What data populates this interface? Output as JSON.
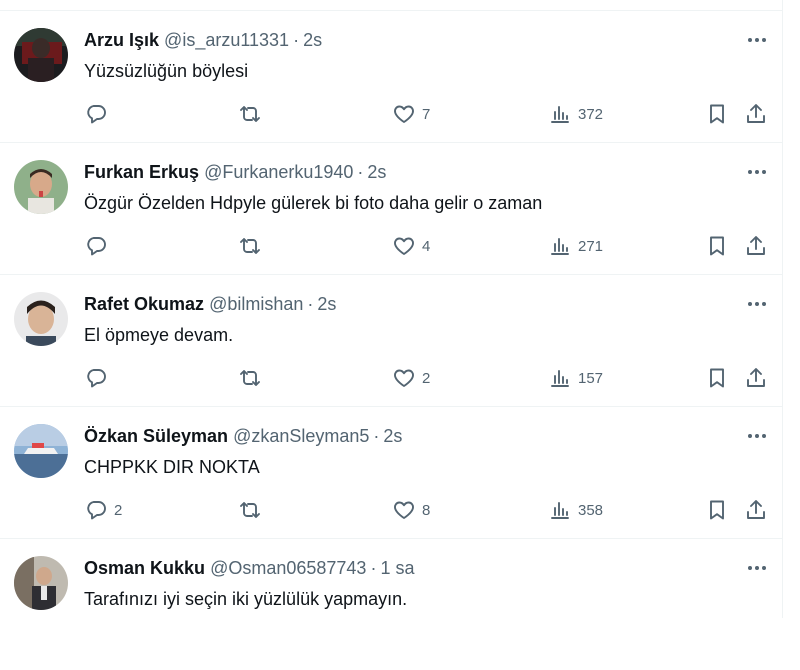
{
  "tweets": [
    {
      "name": "Arzu Işık",
      "handle": "@is_arzu11331",
      "time": "2s",
      "text": "Yüzsüzlüğün böylesi",
      "replies": "",
      "reposts": "",
      "likes": "7",
      "views": "372"
    },
    {
      "name": "Furkan Erkuş",
      "handle": "@Furkanerku1940",
      "time": "2s",
      "text": "Özgür Özelden Hdpyle gülerek bi foto daha gelir o zaman",
      "replies": "",
      "reposts": "",
      "likes": "4",
      "views": "271"
    },
    {
      "name": "Rafet Okumaz",
      "handle": "@bilmishan",
      "time": "2s",
      "text": "El öpmeye devam.",
      "replies": "",
      "reposts": "",
      "likes": "2",
      "views": "157"
    },
    {
      "name": "Özkan Süleyman",
      "handle": "@zkanSleyman5",
      "time": "2s",
      "text": "CHPPKK DIR NOKTA",
      "replies": "2",
      "reposts": "",
      "likes": "8",
      "views": "358"
    },
    {
      "name": "Osman Kukku",
      "handle": "@Osman06587743",
      "time": "1 sa",
      "text": "Tarafınızı iyi seçin iki yüzlülük yapmayın.",
      "replies": "",
      "reposts": "",
      "likes": "",
      "views": ""
    }
  ],
  "icons": {
    "reply": "reply-icon",
    "repost": "repost-icon",
    "like": "heart-icon",
    "views": "views-icon",
    "bookmark": "bookmark-icon",
    "share": "share-icon",
    "more": "more-icon"
  },
  "colors": {
    "text": "#0f1419",
    "secondary": "#536471",
    "border": "#eff3f4"
  }
}
